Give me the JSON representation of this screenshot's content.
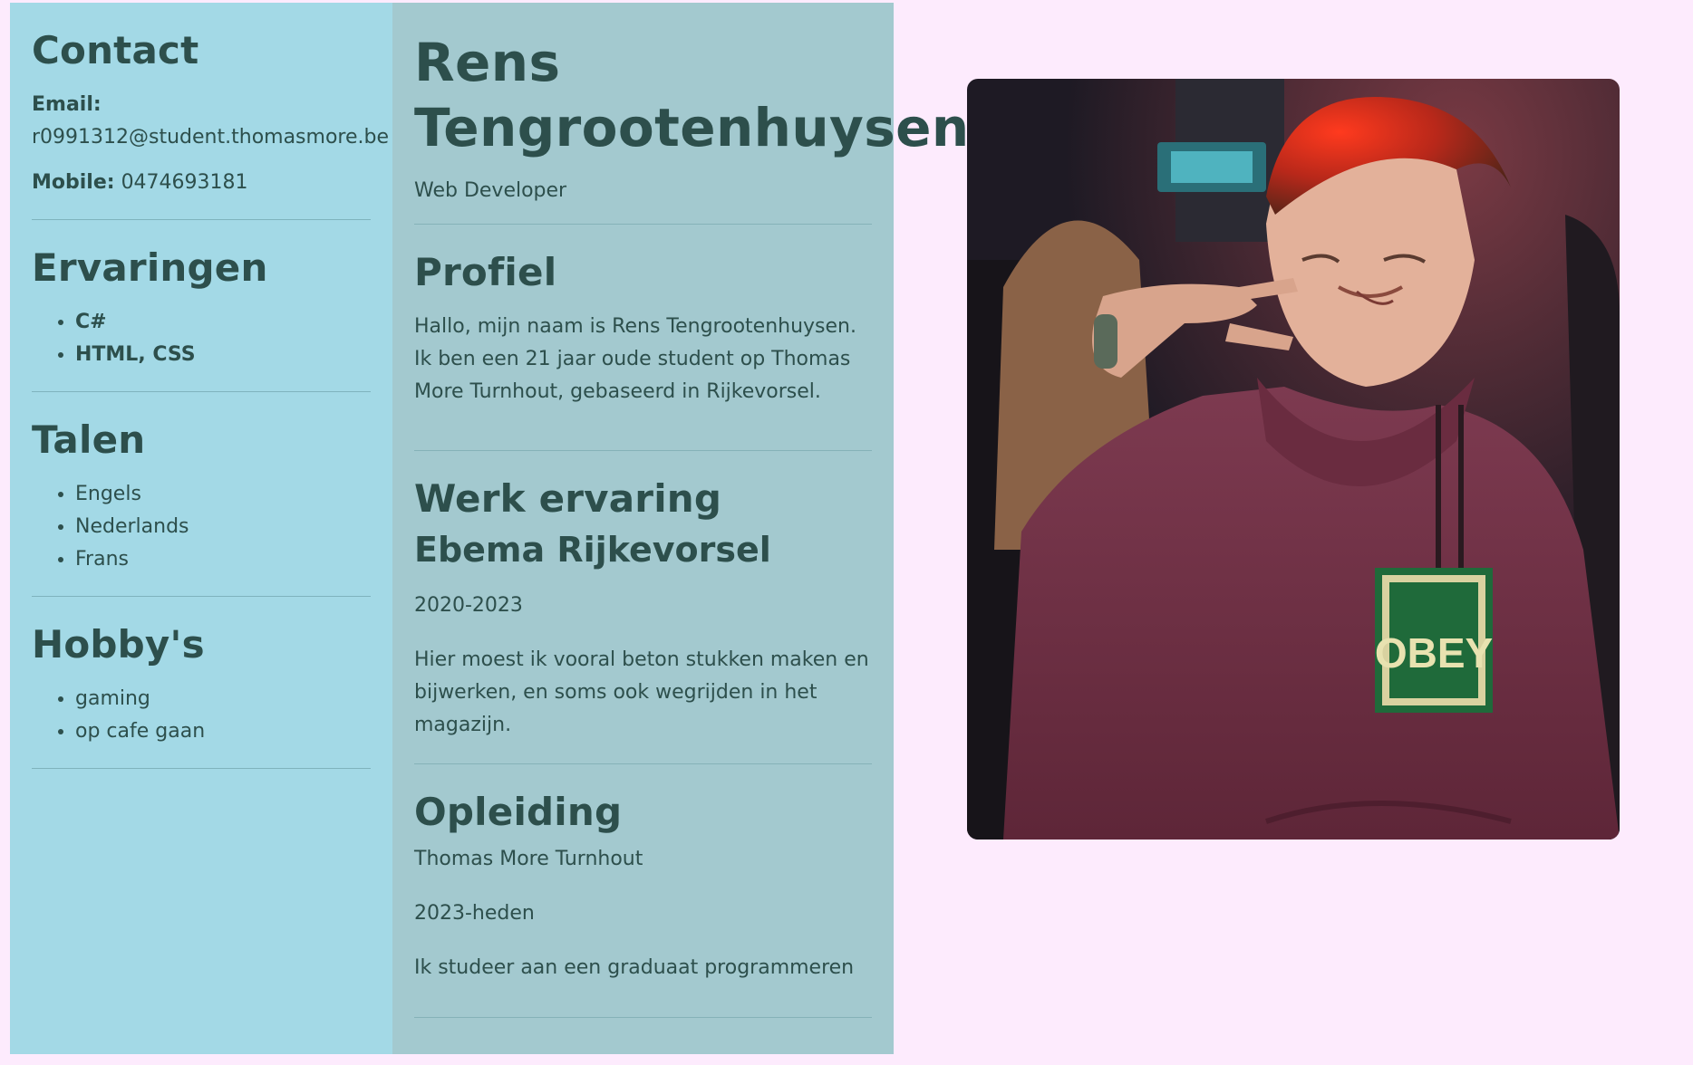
{
  "contact": {
    "heading": "Contact",
    "email_label": "Email:",
    "email_value": "r0991312@student.thomasmore.be",
    "mobile_label": "Mobile:",
    "mobile_value": "0474693181"
  },
  "ervaringen": {
    "heading": "Ervaringen",
    "items": [
      "C#",
      "HTML, CSS"
    ]
  },
  "talen": {
    "heading": "Talen",
    "items": [
      "Engels",
      "Nederlands",
      "Frans"
    ]
  },
  "hobbys": {
    "heading": "Hobby's",
    "items": [
      "gaming",
      "op cafe gaan"
    ]
  },
  "header": {
    "name_line1": "Rens",
    "name_line2": "Tengrootenhuysen",
    "role": "Web Developer"
  },
  "profiel": {
    "heading": "Profiel",
    "text": "Hallo, mijn naam is Rens Tengrootenhuysen. Ik ben een 21 jaar oude student op Thomas More Turnhout, gebaseerd in Rijkevorsel."
  },
  "werk": {
    "heading": "Werk ervaring",
    "company": "Ebema Rijkevorsel",
    "period": "2020-2023",
    "description": "Hier moest ik vooral beton stukken maken en bijwerken, en soms ook wegrijden in het magazijn."
  },
  "opleiding": {
    "heading": "Opleiding",
    "school": "Thomas More Turnhout",
    "period": "2023-heden",
    "description": "Ik studeer aan een graduaat programmeren"
  },
  "photo": {
    "hoodie_logo_text": "OBEY"
  },
  "colors": {
    "page_background": "#fdebfd",
    "sidebar_background": "#a3d9e6",
    "main_background": "#a3c9cf",
    "text": "#2d4f4c"
  }
}
